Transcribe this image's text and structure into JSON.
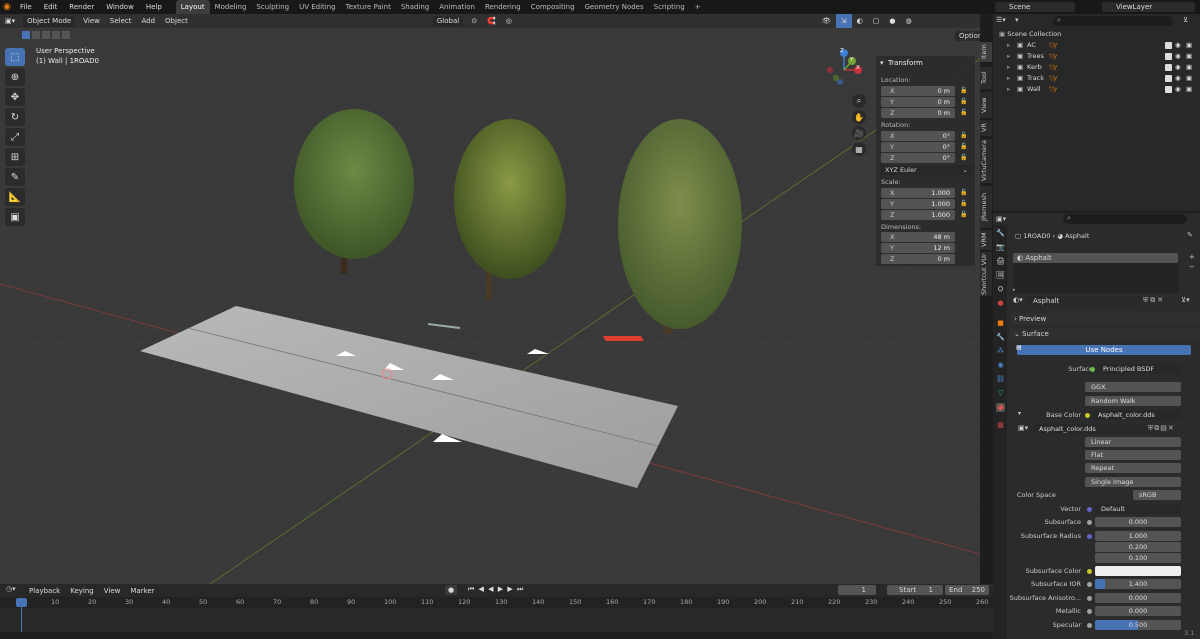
{
  "topbar": {
    "menus": [
      "File",
      "Edit",
      "Render",
      "Window",
      "Help"
    ],
    "workspaces": [
      "Layout",
      "Modeling",
      "Sculpting",
      "UV Editing",
      "Texture Paint",
      "Shading",
      "Animation",
      "Rendering",
      "Compositing",
      "Geometry Nodes",
      "Scripting"
    ],
    "active_workspace": "Layout",
    "add_tab": "+",
    "scene": "Scene",
    "view_layer": "ViewLayer"
  },
  "viewport": {
    "mode": "Object Mode",
    "menus": [
      "View",
      "Select",
      "Add",
      "Object"
    ],
    "orientation": "Global",
    "perspective": "User Perspective",
    "object_info": "(1) Wall | 1ROAD0",
    "options": "Options",
    "gizmo": {
      "x": "X",
      "y": "Y",
      "z": "Z"
    }
  },
  "npanel": {
    "title": "Transform",
    "location_label": "Location:",
    "location": [
      {
        "k": "X",
        "v": "0 m"
      },
      {
        "k": "Y",
        "v": "0 m"
      },
      {
        "k": "Z",
        "v": "0 m"
      }
    ],
    "rotation_label": "Rotation:",
    "rotation": [
      {
        "k": "X",
        "v": "0°"
      },
      {
        "k": "Y",
        "v": "0°"
      },
      {
        "k": "Z",
        "v": "0°"
      }
    ],
    "rotation_mode": "XYZ Euler",
    "scale_label": "Scale:",
    "scale": [
      {
        "k": "X",
        "v": "1.000"
      },
      {
        "k": "Y",
        "v": "1.000"
      },
      {
        "k": "Z",
        "v": "1.000"
      }
    ],
    "dimensions_label": "Dimensions:",
    "dimensions": [
      {
        "k": "X",
        "v": "48 m"
      },
      {
        "k": "Y",
        "v": "12 m"
      },
      {
        "k": "Z",
        "v": "0 m"
      }
    ]
  },
  "side_tabs": [
    "Item",
    "Tool",
    "View",
    "VR",
    "VirtuCamera",
    "JRemesh",
    "VRM",
    "Shortcut VUr"
  ],
  "outliner": {
    "root": "Scene Collection",
    "items": [
      "AC",
      "Trees",
      "Kerb",
      "Track",
      "Wall"
    ]
  },
  "properties": {
    "breadcrumb_object": "1ROAD0",
    "breadcrumb_material": "Asphalt",
    "slot": "Asphalt",
    "material_name": "Asphalt",
    "preview": "Preview",
    "surface_section": "Surface",
    "use_nodes": "Use Nodes",
    "surface_label": "Surface",
    "surface_value": "Principled BSDF",
    "distribution": "GGX",
    "subsurface_method": "Random Walk",
    "base_color_label": "Base Color",
    "base_color_value": "Asphalt_color.dds",
    "image_name": "Asphalt_color.dds",
    "interpolation": "Linear",
    "projection": "Flat",
    "extension": "Repeat",
    "source": "Single Image",
    "color_space_label": "Color Space",
    "color_space": "sRGB",
    "vector_label": "Vector",
    "vector_value": "Default",
    "subsurface_label": "Subsurface",
    "subsurface_value": "0.000",
    "ss_radius_label": "Subsurface Radius",
    "ss_radius": [
      "1.000",
      "0.200",
      "0.100"
    ],
    "ss_color_label": "Subsurface Color",
    "ss_ior_label": "Subsurface IOR",
    "ss_ior_value": "1.400",
    "ss_aniso_label": "Subsurface Anisotro...",
    "ss_aniso_value": "0.000",
    "metallic_label": "Metallic",
    "metallic_value": "0.000",
    "specular_label": "Specular",
    "specular_value": "0.500"
  },
  "timeline": {
    "menus": [
      "Playback",
      "Keying",
      "View",
      "Marker"
    ],
    "current_frame": "1",
    "start_label": "Start",
    "start": "1",
    "end_label": "End",
    "end": "250",
    "ticks": [
      "1",
      "10",
      "20",
      "30",
      "40",
      "50",
      "60",
      "70",
      "80",
      "90",
      "100",
      "110",
      "120",
      "130",
      "140",
      "150",
      "160",
      "170",
      "180",
      "190",
      "200",
      "210",
      "220",
      "230",
      "240",
      "250",
      "260"
    ],
    "version": "3.1"
  },
  "colors": {
    "accent": "#4772b3",
    "logo": "#e87d0d",
    "x_axis": "#c8323c",
    "y_axis": "#74a337",
    "z_axis": "#3a7fd4"
  }
}
